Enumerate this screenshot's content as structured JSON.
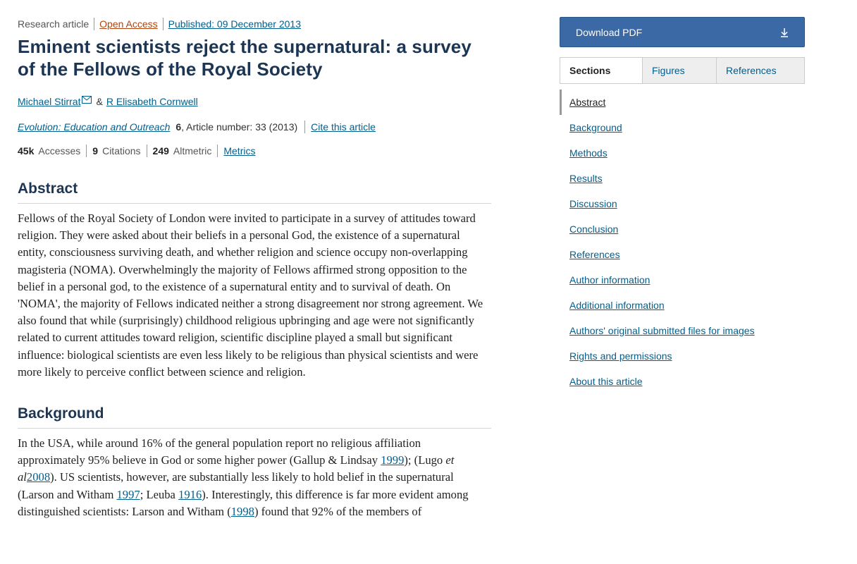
{
  "article": {
    "type": "Research article",
    "access": "Open Access",
    "published": "Published: 09 December 2013",
    "title": "Eminent scientists reject the supernatural: a survey of the Fellows of the Royal Society",
    "authors": [
      "Michael Stirrat",
      "&",
      "R Elisabeth Cornwell"
    ],
    "journal": "Evolution: Education and Outreach",
    "volume": "6",
    "article_info": ", Article number: 33 (2013)",
    "cite": "Cite this article",
    "stats": {
      "accesses_value": "45k",
      "accesses_label": "Accesses",
      "citations_value": "9",
      "citations_label": "Citations",
      "altmetric_value": "249",
      "altmetric_label": "Altmetric",
      "metrics_link": "Metrics"
    }
  },
  "abstract": {
    "heading": "Abstract",
    "text": "Fellows of the Royal Society of London were invited to participate in a survey of attitudes toward religion. They were asked about their beliefs in a personal God, the existence of a supernatural entity, consciousness surviving death, and whether religion and science occupy non-overlapping magisteria (NOMA). Overwhelmingly the majority of Fellows affirmed strong opposition to the belief in a personal god, to the existence of a supernatural entity and to survival of death. On 'NOMA', the majority of Fellows indicated neither a strong disagreement nor strong agreement. We also found that while (surprisingly) childhood religious upbringing and age were not significantly related to current attitudes toward religion, scientific discipline played a small but significant influence: biological scientists are even less likely to be religious than physical scientists and were more likely to perceive conflict between science and religion."
  },
  "background": {
    "heading": "Background",
    "t1": "In the USA, while around 16% of the general population report no religious affiliation approximately 95% believe in God or some higher power (Gallup & Lindsay ",
    "r1": "1999",
    "t2": "); (Lugo ",
    "etal": "et al",
    "r2": "2008",
    "t3": "). US scientists, however, are substantially less likely to hold belief in the supernatural (Larson and Witham ",
    "r3": "1997",
    "t4": "; Leuba ",
    "r4": "1916",
    "t5": "). Interestingly, this difference is far more evident among distinguished scientists: Larson and Witham (",
    "r5": "1998",
    "t6": ") found that 92% of the members of"
  },
  "sidebar": {
    "download_label": "Download PDF",
    "download_icon": "download-icon",
    "tabs": [
      "Sections",
      "Figures",
      "References"
    ],
    "toc": [
      "Abstract",
      "Background",
      "Methods",
      "Results",
      "Discussion",
      "Conclusion",
      "References",
      "Author information",
      "Additional information",
      "Authors' original submitted files for images",
      "Rights and permissions",
      "About this article"
    ]
  },
  "colors": {
    "title": "#1c3553",
    "link": "#025e8d",
    "open_access": "#b1440e",
    "button": "#3a69a6"
  }
}
